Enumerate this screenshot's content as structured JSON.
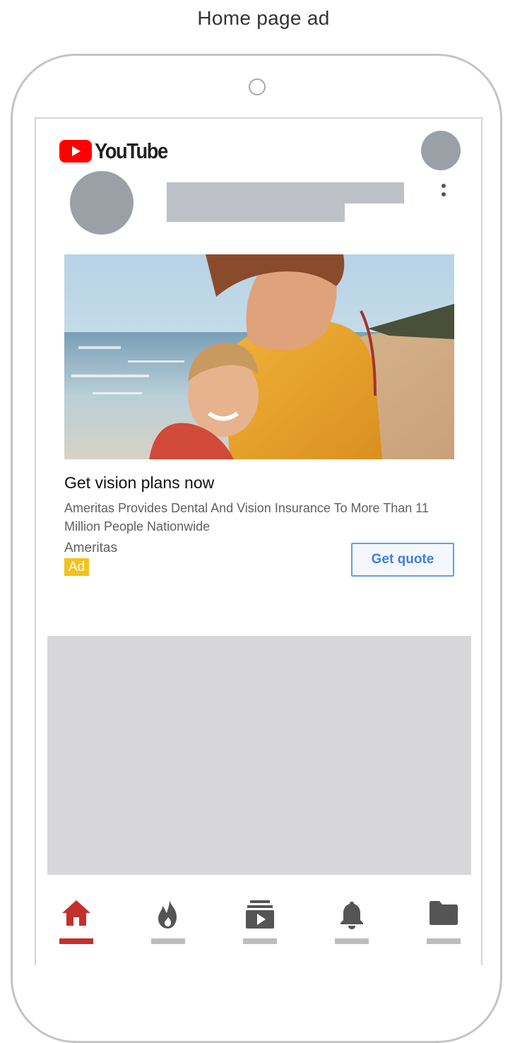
{
  "caption": "Home page ad",
  "header": {
    "logo_text": "YouTube",
    "logo_color": "#ff0000"
  },
  "ad": {
    "image_description_icon": "ad-photo",
    "title": "Get vision plans now",
    "description": "Ameritas Provides Dental And Vision Insurance To More Than 11 Million People Nationwide",
    "advertiser": "Ameritas",
    "badge": "Ad",
    "badge_color": "#f4c11f",
    "cta_label": "Get quote",
    "cta_color": "#3f7ee0"
  },
  "nav": {
    "items": [
      {
        "name": "home",
        "icon": "home-icon",
        "active": true
      },
      {
        "name": "trending",
        "icon": "fire-icon",
        "active": false
      },
      {
        "name": "subscriptions",
        "icon": "subscriptions-icon",
        "active": false
      },
      {
        "name": "notifications",
        "icon": "bell-icon",
        "active": false
      },
      {
        "name": "library",
        "icon": "folder-icon",
        "active": false
      }
    ],
    "active_color": "#c4302b",
    "inactive_color": "#555555"
  }
}
